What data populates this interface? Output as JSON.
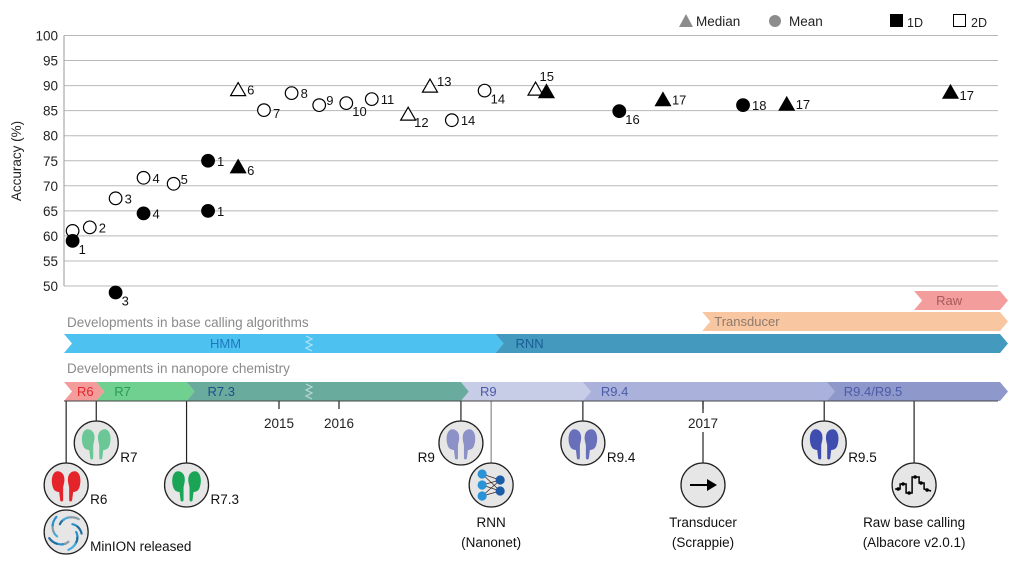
{
  "chart_data": {
    "type": "scatter",
    "title": "",
    "xlabel": "",
    "ylabel": "Accuracy (%)",
    "ylim": [
      50,
      100
    ],
    "yticks": [
      50,
      55,
      60,
      65,
      70,
      75,
      80,
      85,
      90,
      95,
      100
    ],
    "grid": true,
    "x_axis": {
      "type": "time",
      "unit": "year",
      "tick_labels": [
        {
          "year": 2015,
          "label": "2015"
        },
        {
          "year": 2016,
          "label": "2016"
        },
        {
          "year": 2017,
          "label": "2017"
        }
      ],
      "axis_break_between": [
        2015,
        2016
      ]
    },
    "legend": {
      "placement": "top-right",
      "marker_color": "#8c8c8c",
      "shape_entries": [
        {
          "label": "Median",
          "shape": "triangle"
        },
        {
          "label": "Mean",
          "shape": "circle"
        }
      ],
      "read_entries": [
        {
          "label": "1D",
          "style": "filled"
        },
        {
          "label": "2D",
          "style": "open"
        }
      ]
    },
    "points": [
      {
        "label": "",
        "x": 2014.04,
        "y": 61.0,
        "stat": "mean",
        "read": "2D",
        "pos": "right"
      },
      {
        "label": "1",
        "x": 2014.04,
        "y": 59.0,
        "stat": "mean",
        "read": "1D",
        "pos": "below-right"
      },
      {
        "label": "2",
        "x": 2014.12,
        "y": 61.7,
        "stat": "mean",
        "read": "2D",
        "pos": "right"
      },
      {
        "label": "3",
        "x": 2014.24,
        "y": 48.7,
        "stat": "mean",
        "read": "1D",
        "pos": "below-right"
      },
      {
        "label": "3",
        "x": 2014.24,
        "y": 67.5,
        "stat": "mean",
        "read": "2D",
        "pos": "right"
      },
      {
        "label": "4",
        "x": 2014.37,
        "y": 64.5,
        "stat": "mean",
        "read": "1D",
        "pos": "right"
      },
      {
        "label": "4",
        "x": 2014.37,
        "y": 71.6,
        "stat": "mean",
        "read": "2D",
        "pos": "right"
      },
      {
        "label": "5",
        "x": 2014.51,
        "y": 70.4,
        "stat": "mean",
        "read": "2D",
        "pos": "above-right"
      },
      {
        "label": "1",
        "x": 2014.67,
        "y": 75.0,
        "stat": "mean",
        "read": "1D",
        "pos": "right"
      },
      {
        "label": "1",
        "x": 2014.67,
        "y": 65.0,
        "stat": "mean",
        "read": "1D",
        "pos": "right"
      },
      {
        "label": "6",
        "x": 2014.81,
        "y": 73.8,
        "stat": "median",
        "read": "1D",
        "pos": "right-low"
      },
      {
        "label": "6",
        "x": 2014.81,
        "y": 89.2,
        "stat": "median",
        "read": "2D",
        "pos": "right"
      },
      {
        "label": "7",
        "x": 2014.93,
        "y": 85.1,
        "stat": "mean",
        "read": "2D",
        "pos": "right-low"
      },
      {
        "label": "8",
        "x": 2015.21,
        "y": 88.5,
        "stat": "mean",
        "read": "2D",
        "pos": "right"
      },
      {
        "label": "9",
        "x": 2015.67,
        "y": 86.1,
        "stat": "mean",
        "read": "2D",
        "pos": "above-right"
      },
      {
        "label": "10",
        "x": 2016.02,
        "y": 86.5,
        "stat": "mean",
        "read": "2D",
        "pos": "below-right"
      },
      {
        "label": "11",
        "x": 2016.09,
        "y": 87.3,
        "stat": "mean",
        "read": "2D",
        "pos": "right"
      },
      {
        "label": "12",
        "x": 2016.19,
        "y": 84.3,
        "stat": "median",
        "read": "2D",
        "pos": "below-right"
      },
      {
        "label": "13",
        "x": 2016.25,
        "y": 89.9,
        "stat": "median",
        "read": "2D",
        "pos": "above-right"
      },
      {
        "label": "14",
        "x": 2016.31,
        "y": 83.1,
        "stat": "mean",
        "read": "2D",
        "pos": "right"
      },
      {
        "label": "14",
        "x": 2016.4,
        "y": 89.0,
        "stat": "mean",
        "read": "2D",
        "pos": "below-right"
      },
      {
        "label": "15",
        "x": 2016.54,
        "y": 89.3,
        "stat": "median",
        "read": "2D",
        "pos": "top"
      },
      {
        "label": "",
        "x": 2016.57,
        "y": 88.8,
        "stat": "median",
        "read": "1D",
        "pos": "right"
      },
      {
        "label": "16",
        "x": 2016.77,
        "y": 84.9,
        "stat": "mean",
        "read": "1D",
        "pos": "below-right"
      },
      {
        "label": "17",
        "x": 2016.89,
        "y": 87.2,
        "stat": "median",
        "read": "1D",
        "pos": "right"
      },
      {
        "label": "18",
        "x": 2017.11,
        "y": 86.1,
        "stat": "mean",
        "read": "1D",
        "pos": "right"
      },
      {
        "label": "17",
        "x": 2017.23,
        "y": 86.3,
        "stat": "median",
        "read": "1D",
        "pos": "right"
      },
      {
        "label": "17",
        "x": 2017.68,
        "y": 88.7,
        "stat": "median",
        "read": "1D",
        "pos": "right-low"
      }
    ]
  },
  "timeline": {
    "algorithms_heading": "Developments in base calling algorithms",
    "chemistry_heading": "Developments in nanopore chemistry",
    "algorithm_bars": [
      {
        "label": "HMM",
        "start": 2014.0,
        "end": 2016.43,
        "color": "#4dc2f0",
        "text_color": "#1e78be"
      },
      {
        "label": "RNN",
        "start": 2016.43,
        "end": 2017.816,
        "color": "#4499bf",
        "text_color": "#1b5c94"
      },
      {
        "label": "Transducer",
        "start": 2016.998,
        "end": 2017.816,
        "color": "#f8c6a0",
        "text_color": "#8e7a6e"
      },
      {
        "label": "Raw",
        "start": 2017.58,
        "end": 2017.816,
        "color": "#f39d9c",
        "text_color": "#a95a5c"
      }
    ],
    "chemistry_bars": [
      {
        "label": "R6",
        "start": 2014.0,
        "end": 2014.15,
        "color": "#f39c9a",
        "text_color": "#e0262e"
      },
      {
        "label": "R7",
        "start": 2014.15,
        "end": 2014.57,
        "color": "#6fd08f",
        "text_color": "#2a9a58"
      },
      {
        "label": "R7.3",
        "start": 2014.57,
        "end": 2016.335,
        "color": "#69ab9d",
        "text_color": "#1f4e8e"
      },
      {
        "label": "R9",
        "start": 2016.335,
        "end": 2016.67,
        "color": "#c7cce7",
        "text_color": "#4b5ba8"
      },
      {
        "label": "R9.4",
        "start": 2016.67,
        "end": 2017.34,
        "color": "#aab2dc",
        "text_color": "#4b5ba8"
      },
      {
        "label": "R9.4/R9.5",
        "start": 2017.34,
        "end": 2017.816,
        "color": "#8e98cb",
        "text_color": "#4b5ba8"
      }
    ],
    "events": [
      {
        "label": [
          "R6"
        ],
        "year": 2014.01,
        "icon": "pore",
        "color": "#e5232b",
        "tier": "lower",
        "label_side": "right"
      },
      {
        "label": [
          "MinION released"
        ],
        "year": 2014.01,
        "icon": "minion",
        "tier": "bottom",
        "label_side": "right"
      },
      {
        "label": [
          "R7"
        ],
        "year": 2014.15,
        "icon": "pore",
        "color": "#6bc795",
        "tier": "upper",
        "label_side": "right"
      },
      {
        "label": [
          "R7.3"
        ],
        "year": 2014.57,
        "icon": "pore",
        "color": "#1aa556",
        "tier": "lower",
        "label_side": "right"
      },
      {
        "label": [
          "R9"
        ],
        "year": 2016.335,
        "icon": "pore",
        "color": "#8c91c7",
        "tier": "upper",
        "label_side": "left"
      },
      {
        "label": [
          "RNN",
          "(Nanonet)"
        ],
        "year": 2016.418,
        "icon": "network",
        "tier": "lower",
        "label_side": "below"
      },
      {
        "label": [
          "R9.4"
        ],
        "year": 2016.67,
        "icon": "pore",
        "color": "#6870bb",
        "tier": "upper",
        "label_side": "right"
      },
      {
        "label": [
          "Transducer",
          "(Scrappie)"
        ],
        "year": 2017.0,
        "icon": "arrow",
        "tier": "lower",
        "label_side": "below"
      },
      {
        "label": [
          "R9.5"
        ],
        "year": 2017.333,
        "icon": "pore",
        "color": "#3f4dae",
        "tier": "upper",
        "label_side": "right"
      },
      {
        "label": [
          "Raw base calling",
          "(Albacore v2.0.1)"
        ],
        "year": 2017.58,
        "icon": "squiggle",
        "tier": "lower",
        "label_side": "below"
      }
    ]
  }
}
